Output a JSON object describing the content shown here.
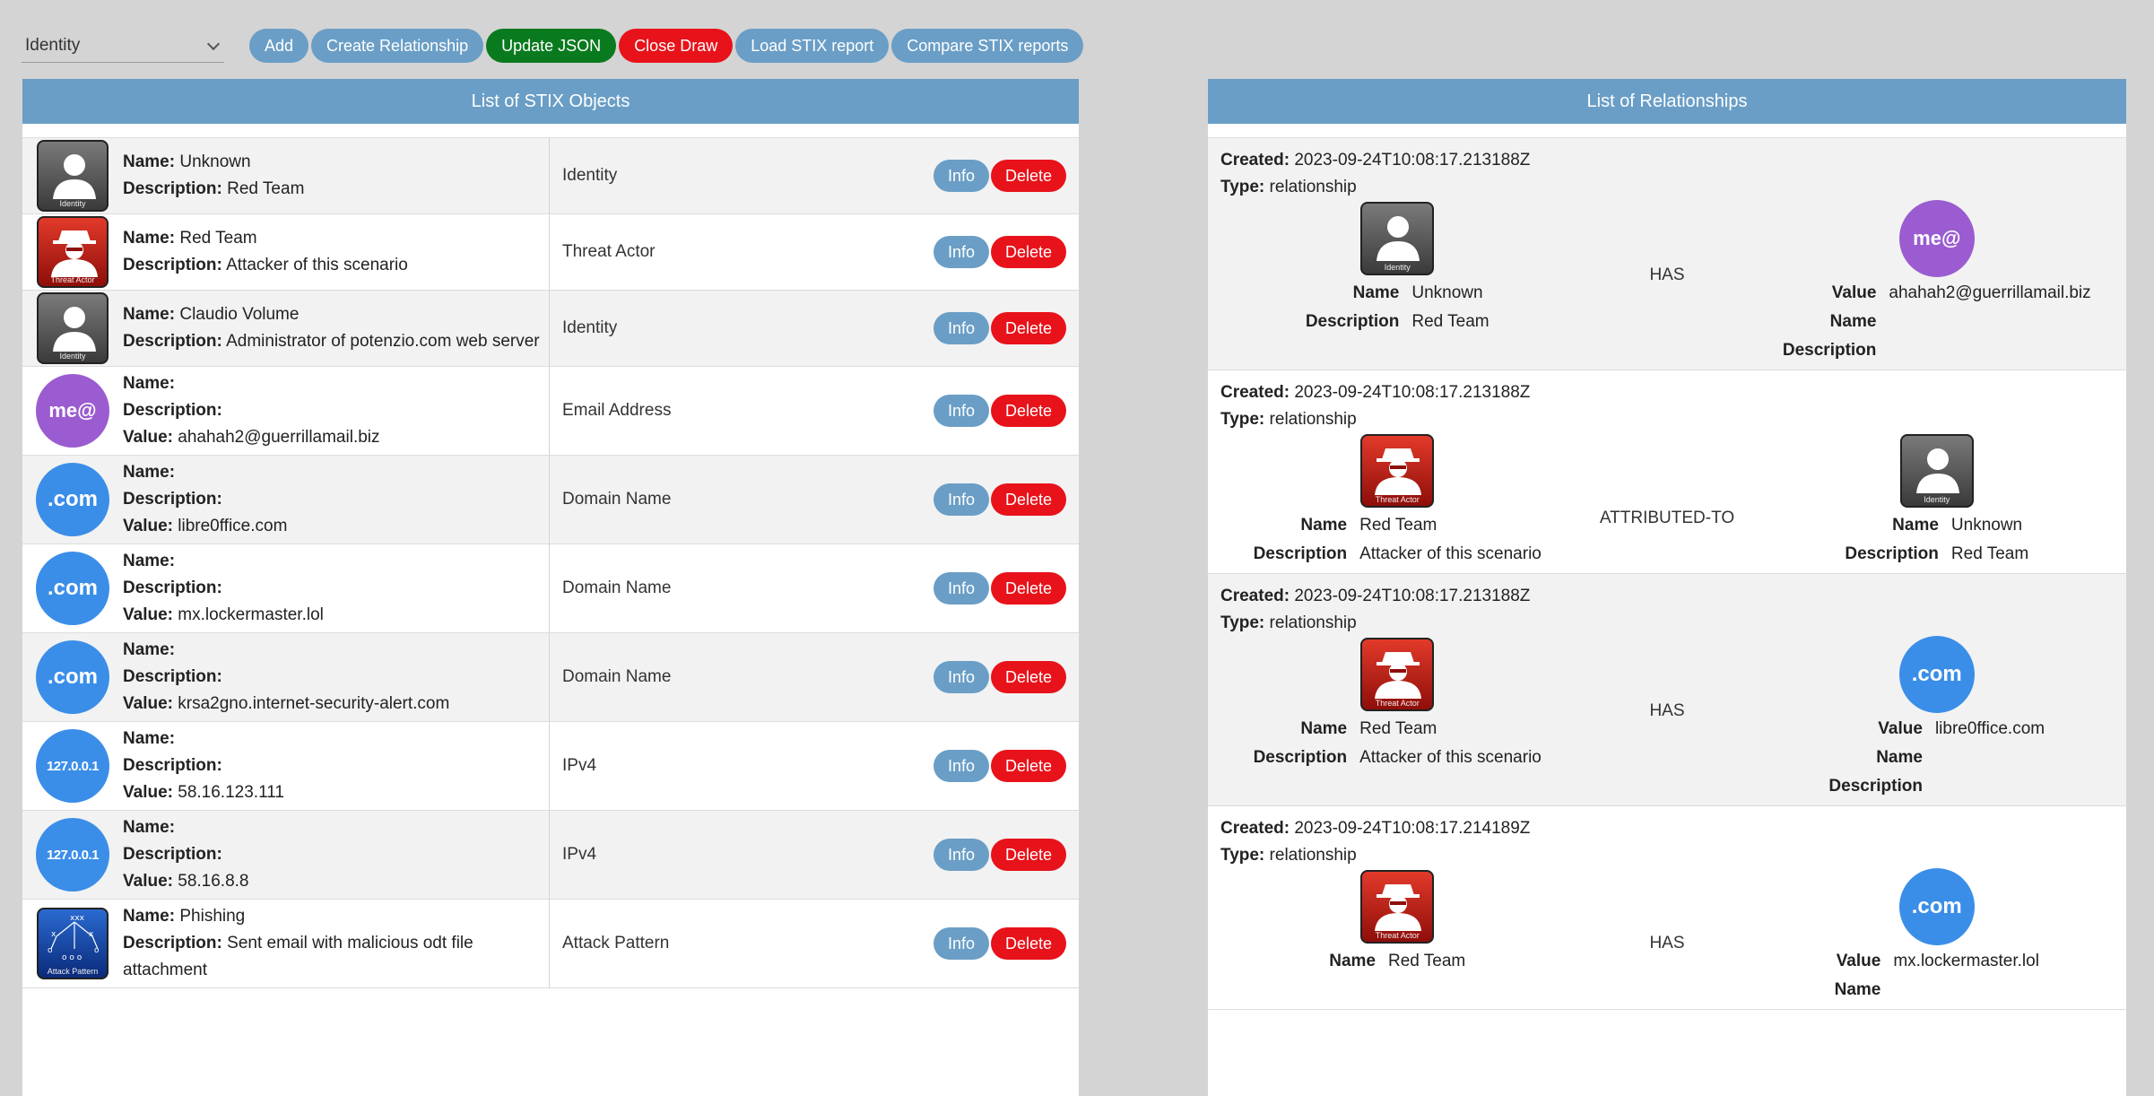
{
  "toolbar": {
    "type_select_value": "Identity",
    "buttons": {
      "add": "Add",
      "create_relationship": "Create Relationship",
      "update_json": "Update JSON",
      "close_draw": "Close Draw",
      "load_stix": "Load STIX report",
      "compare_stix": "Compare STIX reports"
    }
  },
  "labels": {
    "name": "Name:",
    "description": "Description:",
    "value": "Value:",
    "created": "Created:",
    "type": "Type:",
    "info": "Info",
    "delete": "Delete",
    "k_name": "Name",
    "k_description": "Description",
    "k_value": "Value"
  },
  "icon_captions": {
    "identity": "Identity",
    "threat_actor": "Threat Actor",
    "attack_pattern": "Attack Pattern",
    "email": "me@",
    "domain": ".com",
    "ipv4": "127.0.0.1"
  },
  "objects_panel": {
    "title": "List of STIX Objects",
    "items": [
      {
        "icon": "identity-icon",
        "name": "Unknown",
        "description": "Red Team",
        "type": "Identity"
      },
      {
        "icon": "threat-actor-icon",
        "name": "Red Team",
        "description": "Attacker of this scenario",
        "type": "Threat Actor"
      },
      {
        "icon": "identity-icon",
        "name": "Claudio Volume",
        "description": "Administrator of potenzio.com web server",
        "type": "Identity"
      },
      {
        "icon": "email-address-icon",
        "name": "",
        "description": "",
        "value": "ahahah2@guerrillamail.biz",
        "type": "Email Address"
      },
      {
        "icon": "domain-name-icon",
        "name": "",
        "description": "",
        "value": "libre0ffice.com",
        "type": "Domain Name"
      },
      {
        "icon": "domain-name-icon",
        "name": "",
        "description": "",
        "value": "mx.lockermaster.lol",
        "type": "Domain Name"
      },
      {
        "icon": "domain-name-icon",
        "name": "",
        "description": "",
        "value": "krsa2gno.internet-security-alert.com",
        "type": "Domain Name"
      },
      {
        "icon": "ipv4-icon",
        "name": "",
        "description": "",
        "value": "58.16.123.111",
        "type": "IPv4"
      },
      {
        "icon": "ipv4-icon",
        "name": "",
        "description": "",
        "value": "58.16.8.8",
        "type": "IPv4"
      },
      {
        "icon": "attack-pattern-icon",
        "name": "Phishing",
        "description": "Sent email with malicious odt file attachment",
        "type": "Attack Pattern"
      }
    ]
  },
  "relationships_panel": {
    "title": "List of Relationships",
    "items": [
      {
        "created": "2023-09-24T10:08:17.213188Z",
        "type": "relationship",
        "relationship_type": "HAS",
        "source": {
          "icon": "identity-icon",
          "name": "Unknown",
          "description": "Red Team"
        },
        "target": {
          "icon": "email-address-icon",
          "value": "ahahah2@guerrillamail.biz",
          "name": "",
          "description": ""
        }
      },
      {
        "created": "2023-09-24T10:08:17.213188Z",
        "type": "relationship",
        "relationship_type": "ATTRIBUTED-TO",
        "source": {
          "icon": "threat-actor-icon",
          "name": "Red Team",
          "description": "Attacker of this scenario"
        },
        "target": {
          "icon": "identity-icon",
          "name": "Unknown",
          "description": "Red Team"
        }
      },
      {
        "created": "2023-09-24T10:08:17.213188Z",
        "type": "relationship",
        "relationship_type": "HAS",
        "source": {
          "icon": "threat-actor-icon",
          "name": "Red Team",
          "description": "Attacker of this scenario"
        },
        "target": {
          "icon": "domain-name-icon",
          "value": "libre0ffice.com",
          "name": "",
          "description": ""
        }
      },
      {
        "created": "2023-09-24T10:08:17.214189Z",
        "type": "relationship",
        "relationship_type": "HAS",
        "source": {
          "icon": "threat-actor-icon",
          "name": "Red Team"
        },
        "target": {
          "icon": "domain-name-icon",
          "value": "mx.lockermaster.lol",
          "name": ""
        }
      }
    ]
  },
  "colors": {
    "header_blue": "#6a9ec6",
    "update_green": "#0a7a1e",
    "danger_red": "#e8121a",
    "email_purple": "#9a5cd0",
    "domain_blue": "#3a8ee8"
  }
}
